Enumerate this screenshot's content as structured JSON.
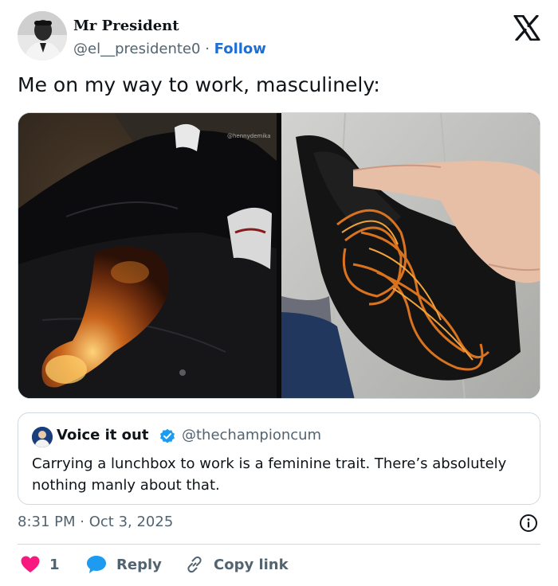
{
  "author": {
    "name": "Mr President",
    "handle": "@el__presidente0",
    "separator": "·",
    "follow_label": "Follow"
  },
  "tweet": {
    "text": "Me on my way to work, masculinely:",
    "watermark": "@hennydemika"
  },
  "quoted_tweet": {
    "name": "Voice it out",
    "handle": "@thechampioncum",
    "text": "Carrying a lunchbox to work is a feminine trait. There’s absolutely nothing manly about that."
  },
  "meta": {
    "time": "8:31 PM",
    "separator": "·",
    "date": "Oct 3, 2025"
  },
  "actions": {
    "like_count": "1",
    "reply_label": "Reply",
    "copy_link_label": "Copy link"
  },
  "colors": {
    "like": "#f91880",
    "reply": "#1d9bf0",
    "link": "#1d6fd6",
    "muted": "#536471",
    "verified": "#1d9bf0"
  },
  "icons": {
    "logo": "x-logo-icon",
    "verified": "verified-badge-icon",
    "info": "info-icon",
    "like": "heart-icon",
    "reply": "speech-bubble-icon",
    "copy_link": "link-icon"
  }
}
